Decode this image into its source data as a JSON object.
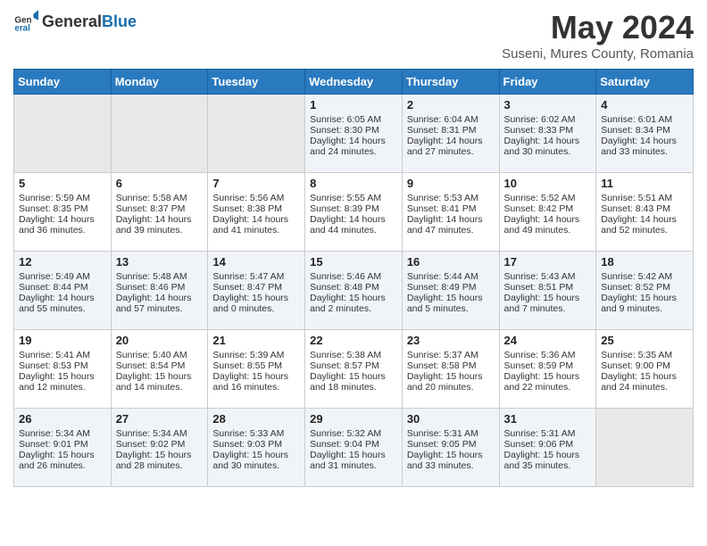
{
  "logo": {
    "text_general": "General",
    "text_blue": "Blue"
  },
  "title": {
    "month_year": "May 2024",
    "location": "Suseni, Mures County, Romania"
  },
  "days_of_week": [
    "Sunday",
    "Monday",
    "Tuesday",
    "Wednesday",
    "Thursday",
    "Friday",
    "Saturday"
  ],
  "weeks": [
    [
      {
        "day": "",
        "empty": true
      },
      {
        "day": "",
        "empty": true
      },
      {
        "day": "",
        "empty": true
      },
      {
        "day": "1",
        "sunrise": "Sunrise: 6:05 AM",
        "sunset": "Sunset: 8:30 PM",
        "daylight": "Daylight: 14 hours and 24 minutes."
      },
      {
        "day": "2",
        "sunrise": "Sunrise: 6:04 AM",
        "sunset": "Sunset: 8:31 PM",
        "daylight": "Daylight: 14 hours and 27 minutes."
      },
      {
        "day": "3",
        "sunrise": "Sunrise: 6:02 AM",
        "sunset": "Sunset: 8:33 PM",
        "daylight": "Daylight: 14 hours and 30 minutes."
      },
      {
        "day": "4",
        "sunrise": "Sunrise: 6:01 AM",
        "sunset": "Sunset: 8:34 PM",
        "daylight": "Daylight: 14 hours and 33 minutes."
      }
    ],
    [
      {
        "day": "5",
        "sunrise": "Sunrise: 5:59 AM",
        "sunset": "Sunset: 8:35 PM",
        "daylight": "Daylight: 14 hours and 36 minutes."
      },
      {
        "day": "6",
        "sunrise": "Sunrise: 5:58 AM",
        "sunset": "Sunset: 8:37 PM",
        "daylight": "Daylight: 14 hours and 39 minutes."
      },
      {
        "day": "7",
        "sunrise": "Sunrise: 5:56 AM",
        "sunset": "Sunset: 8:38 PM",
        "daylight": "Daylight: 14 hours and 41 minutes."
      },
      {
        "day": "8",
        "sunrise": "Sunrise: 5:55 AM",
        "sunset": "Sunset: 8:39 PM",
        "daylight": "Daylight: 14 hours and 44 minutes."
      },
      {
        "day": "9",
        "sunrise": "Sunrise: 5:53 AM",
        "sunset": "Sunset: 8:41 PM",
        "daylight": "Daylight: 14 hours and 47 minutes."
      },
      {
        "day": "10",
        "sunrise": "Sunrise: 5:52 AM",
        "sunset": "Sunset: 8:42 PM",
        "daylight": "Daylight: 14 hours and 49 minutes."
      },
      {
        "day": "11",
        "sunrise": "Sunrise: 5:51 AM",
        "sunset": "Sunset: 8:43 PM",
        "daylight": "Daylight: 14 hours and 52 minutes."
      }
    ],
    [
      {
        "day": "12",
        "sunrise": "Sunrise: 5:49 AM",
        "sunset": "Sunset: 8:44 PM",
        "daylight": "Daylight: 14 hours and 55 minutes."
      },
      {
        "day": "13",
        "sunrise": "Sunrise: 5:48 AM",
        "sunset": "Sunset: 8:46 PM",
        "daylight": "Daylight: 14 hours and 57 minutes."
      },
      {
        "day": "14",
        "sunrise": "Sunrise: 5:47 AM",
        "sunset": "Sunset: 8:47 PM",
        "daylight": "Daylight: 15 hours and 0 minutes."
      },
      {
        "day": "15",
        "sunrise": "Sunrise: 5:46 AM",
        "sunset": "Sunset: 8:48 PM",
        "daylight": "Daylight: 15 hours and 2 minutes."
      },
      {
        "day": "16",
        "sunrise": "Sunrise: 5:44 AM",
        "sunset": "Sunset: 8:49 PM",
        "daylight": "Daylight: 15 hours and 5 minutes."
      },
      {
        "day": "17",
        "sunrise": "Sunrise: 5:43 AM",
        "sunset": "Sunset: 8:51 PM",
        "daylight": "Daylight: 15 hours and 7 minutes."
      },
      {
        "day": "18",
        "sunrise": "Sunrise: 5:42 AM",
        "sunset": "Sunset: 8:52 PM",
        "daylight": "Daylight: 15 hours and 9 minutes."
      }
    ],
    [
      {
        "day": "19",
        "sunrise": "Sunrise: 5:41 AM",
        "sunset": "Sunset: 8:53 PM",
        "daylight": "Daylight: 15 hours and 12 minutes."
      },
      {
        "day": "20",
        "sunrise": "Sunrise: 5:40 AM",
        "sunset": "Sunset: 8:54 PM",
        "daylight": "Daylight: 15 hours and 14 minutes."
      },
      {
        "day": "21",
        "sunrise": "Sunrise: 5:39 AM",
        "sunset": "Sunset: 8:55 PM",
        "daylight": "Daylight: 15 hours and 16 minutes."
      },
      {
        "day": "22",
        "sunrise": "Sunrise: 5:38 AM",
        "sunset": "Sunset: 8:57 PM",
        "daylight": "Daylight: 15 hours and 18 minutes."
      },
      {
        "day": "23",
        "sunrise": "Sunrise: 5:37 AM",
        "sunset": "Sunset: 8:58 PM",
        "daylight": "Daylight: 15 hours and 20 minutes."
      },
      {
        "day": "24",
        "sunrise": "Sunrise: 5:36 AM",
        "sunset": "Sunset: 8:59 PM",
        "daylight": "Daylight: 15 hours and 22 minutes."
      },
      {
        "day": "25",
        "sunrise": "Sunrise: 5:35 AM",
        "sunset": "Sunset: 9:00 PM",
        "daylight": "Daylight: 15 hours and 24 minutes."
      }
    ],
    [
      {
        "day": "26",
        "sunrise": "Sunrise: 5:34 AM",
        "sunset": "Sunset: 9:01 PM",
        "daylight": "Daylight: 15 hours and 26 minutes."
      },
      {
        "day": "27",
        "sunrise": "Sunrise: 5:34 AM",
        "sunset": "Sunset: 9:02 PM",
        "daylight": "Daylight: 15 hours and 28 minutes."
      },
      {
        "day": "28",
        "sunrise": "Sunrise: 5:33 AM",
        "sunset": "Sunset: 9:03 PM",
        "daylight": "Daylight: 15 hours and 30 minutes."
      },
      {
        "day": "29",
        "sunrise": "Sunrise: 5:32 AM",
        "sunset": "Sunset: 9:04 PM",
        "daylight": "Daylight: 15 hours and 31 minutes."
      },
      {
        "day": "30",
        "sunrise": "Sunrise: 5:31 AM",
        "sunset": "Sunset: 9:05 PM",
        "daylight": "Daylight: 15 hours and 33 minutes."
      },
      {
        "day": "31",
        "sunrise": "Sunrise: 5:31 AM",
        "sunset": "Sunset: 9:06 PM",
        "daylight": "Daylight: 15 hours and 35 minutes."
      },
      {
        "day": "",
        "empty": true
      }
    ]
  ]
}
